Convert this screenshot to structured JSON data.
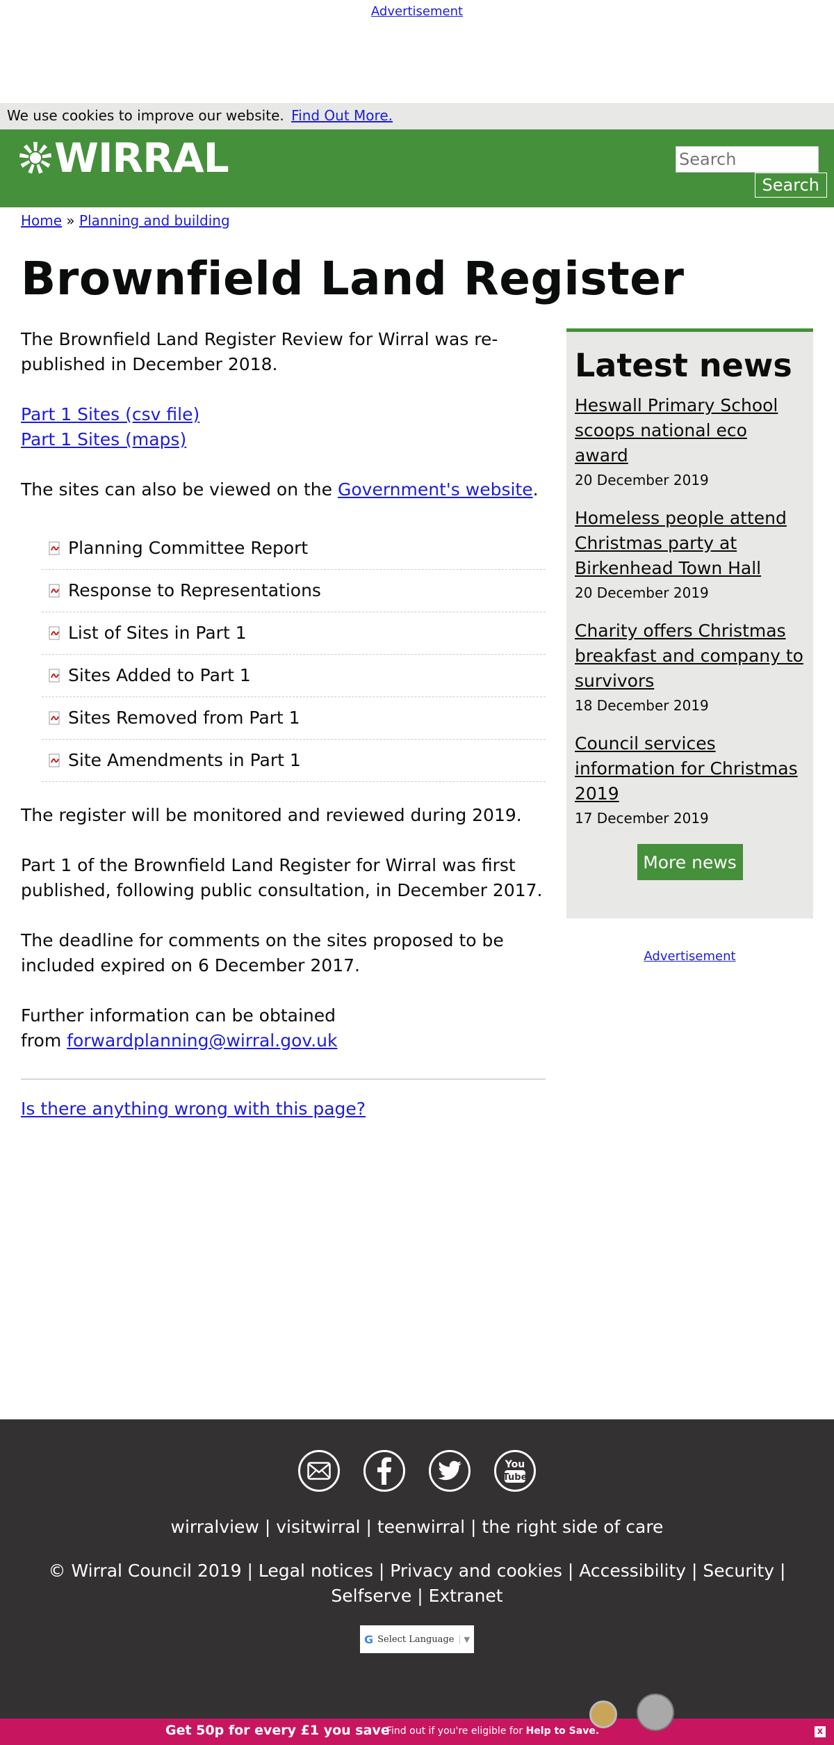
{
  "ad_top": {
    "label": "Advertisement"
  },
  "cookie": {
    "text": "We use cookies to improve our website.",
    "link": "Find Out More."
  },
  "header": {
    "logo_text": "WIRRAL",
    "search_placeholder": "Search",
    "search_button": "Search",
    "brand_color": "#45903a"
  },
  "breadcrumb": {
    "home": "Home",
    "separator": "»",
    "current": "Planning and building"
  },
  "page_title": "Brownfield Land Register",
  "main": {
    "intro": "The Brownfield Land Register Review for Wirral was re-published in December 2018.",
    "link_csv": "Part 1 Sites (csv file)",
    "link_maps": "Part 1 Sites (maps)",
    "gov_text_before": "The sites can also be viewed on the",
    "gov_link": "Government's website",
    "gov_text_after": ".",
    "documents": [
      {
        "label": "Planning Committee Report",
        "icon": "pdf-icon"
      },
      {
        "label": "Response to Representations",
        "icon": "pdf-icon"
      },
      {
        "label": "List of Sites in Part 1",
        "icon": "pdf-icon"
      },
      {
        "label": "Sites Added to Part 1",
        "icon": "pdf-icon"
      },
      {
        "label": "Sites Removed from Part 1",
        "icon": "pdf-icon"
      },
      {
        "label": "Site Amendments in Part 1",
        "icon": "pdf-icon"
      }
    ],
    "para_monitor": "The register will be monitored and reviewed during 2019.",
    "para_published": "Part 1 of the Brownfield Land Register for Wirral was first published, following public consultation, in December 2017.",
    "para_deadline": "The deadline for comments on the sites proposed to be included expired on 6 December 2017.",
    "further_text": "Further information can be obtained from",
    "further_email": "forwardplanning@wirral.gov.uk",
    "feedback_link": "Is there anything wrong with this page?"
  },
  "sidebar": {
    "title": "Latest news",
    "news": [
      {
        "title": "Heswall Primary School scoops national eco award",
        "date": "20 December 2019"
      },
      {
        "title": "Homeless people attend Christmas party at Birkenhead Town Hall",
        "date": "20 December 2019"
      },
      {
        "title": "Charity offers Christmas breakfast and company to survivors",
        "date": "18 December 2019"
      },
      {
        "title": "Council services information for Christmas 2019",
        "date": "17 December 2019"
      }
    ],
    "more_button": "More news",
    "ad_label": "Advertisement"
  },
  "footer": {
    "social_icons": [
      "email-icon",
      "facebook-icon",
      "twitter-icon",
      "youtube-icon"
    ],
    "links_row1": [
      "wirralview",
      "visitwirral",
      "teenwirral",
      "the right side of care"
    ],
    "copyright": "© Wirral Council 2019",
    "links_row2": [
      "Legal notices",
      "Privacy and cookies",
      "Accessibility",
      "Security",
      "Selfserve",
      "Extranet"
    ],
    "separator": "|",
    "language_select": "Select Language",
    "language_g": "G",
    "language_arrow": "▼"
  },
  "banner": {
    "main_text": "Get 50p for every £1 you save",
    "sub_text": "Find out if you're eligible for",
    "sub_bold": "Help to Save.",
    "close": "x",
    "color": "#c8155f"
  }
}
